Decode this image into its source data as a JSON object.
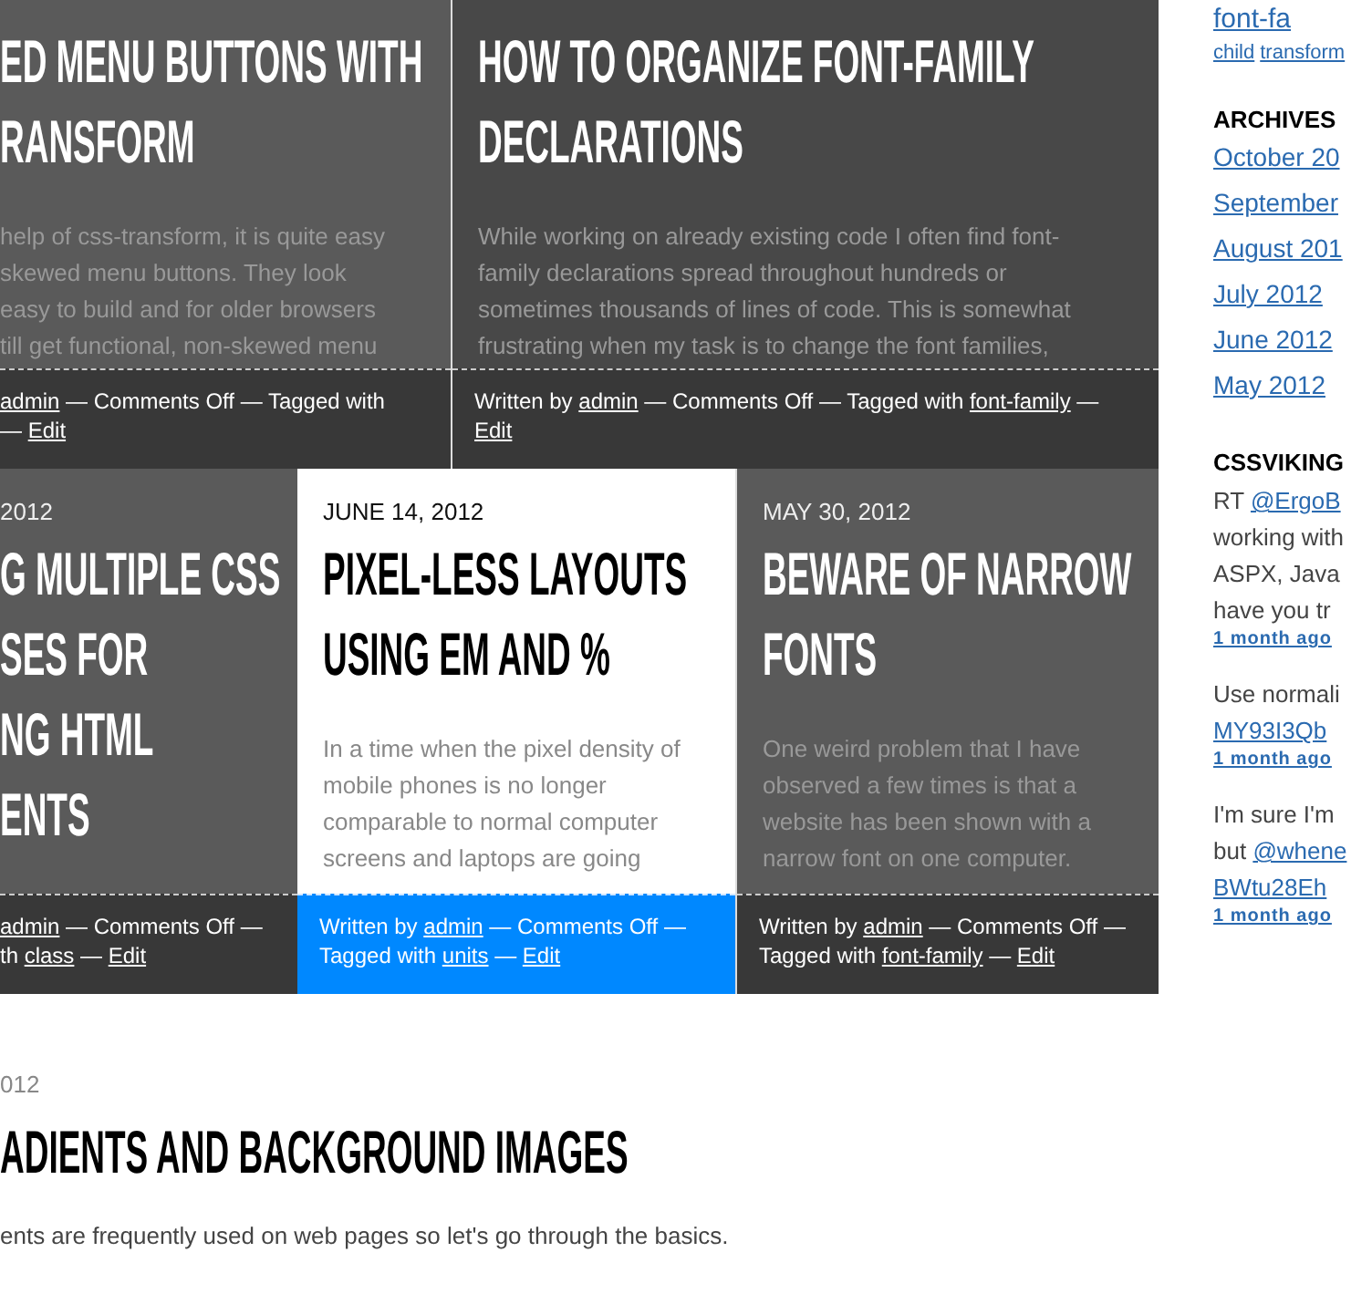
{
  "posts": [
    {
      "kind": "dark",
      "title_lines": [
        "ED MENU BUTTONS WITH",
        "RANSFORM"
      ],
      "excerpt_lines": [
        "help of css-transform, it is quite easy",
        " skewed menu buttons. They look",
        " easy to build and for older browsers",
        "till get functional, non-skewed menu"
      ],
      "footer_lines": [
        [
          {
            "kind": "link",
            "text": "admin"
          },
          {
            "kind": "text",
            "text": " — Comments Off — Tagged with"
          }
        ],
        [
          {
            "kind": "text",
            "text": "— "
          },
          {
            "kind": "link",
            "text": "Edit"
          }
        ]
      ]
    },
    {
      "kind": "darker",
      "title_lines": [
        "HOW TO ORGANIZE FONT-FAMILY",
        "DECLARATIONS"
      ],
      "excerpt_lines": [
        "While working on already existing code I often find font-",
        "family declarations spread throughout hundreds or",
        "sometimes thousands of lines of code. This is somewhat",
        "frustrating when my task is to change the font families,"
      ],
      "footer_lines": [
        [
          {
            "kind": "text",
            "text": "Written by "
          },
          {
            "kind": "link",
            "text": "admin"
          },
          {
            "kind": "text",
            "text": " — Comments Off — Tagged with "
          },
          {
            "kind": "link",
            "text": "font-family"
          },
          {
            "kind": "text",
            "text": " —"
          }
        ],
        [
          {
            "kind": "link",
            "text": "Edit"
          }
        ]
      ]
    },
    {
      "kind": "dark",
      "date": " 2012",
      "title_lines": [
        "G MULTIPLE CSS",
        "SES FOR",
        "NG HTML",
        "ENTS"
      ],
      "footer_lines": [
        [
          {
            "kind": "link",
            "text": "admin"
          },
          {
            "kind": "text",
            "text": " — Comments Off —"
          }
        ],
        [
          {
            "kind": "text",
            "text": "th "
          },
          {
            "kind": "link",
            "text": "class"
          },
          {
            "kind": "text",
            "text": " — "
          },
          {
            "kind": "link",
            "text": "Edit"
          }
        ]
      ]
    },
    {
      "kind": "light",
      "date": "JUNE 14, 2012",
      "title_lines": [
        "PIXEL-LESS LAYOUTS",
        "USING EM AND %"
      ],
      "excerpt_lines": [
        "In a time when the pixel density of",
        "mobile phones is no longer",
        "comparable to normal computer",
        "screens and laptops are going"
      ],
      "footer_lines": [
        [
          {
            "kind": "text",
            "text": "Written by "
          },
          {
            "kind": "link",
            "text": "admin"
          },
          {
            "kind": "text",
            "text": " — Comments Off —"
          }
        ],
        [
          {
            "kind": "text",
            "text": "Tagged with "
          },
          {
            "kind": "link",
            "text": "units"
          },
          {
            "kind": "text",
            "text": " — "
          },
          {
            "kind": "link",
            "text": "Edit"
          }
        ]
      ]
    },
    {
      "kind": "dark",
      "date": "MAY 30, 2012",
      "title_lines": [
        "BEWARE OF NARROW",
        "FONTS"
      ],
      "excerpt_lines": [
        "One weird problem that I have",
        "observed a few times is that a",
        "website has been shown with a",
        "narrow font on one computer."
      ],
      "footer_lines": [
        [
          {
            "kind": "text",
            "text": "Written by "
          },
          {
            "kind": "link",
            "text": "admin"
          },
          {
            "kind": "text",
            "text": " — Comments Off —"
          }
        ],
        [
          {
            "kind": "text",
            "text": "Tagged with "
          },
          {
            "kind": "link",
            "text": "font-family"
          },
          {
            "kind": "text",
            "text": " — "
          },
          {
            "kind": "link",
            "text": "Edit"
          }
        ]
      ]
    }
  ],
  "article": {
    "date": "012",
    "title": "ADIENTS AND BACKGROUND IMAGES",
    "excerpt": "ents are frequently used on web pages so let's go through the basics."
  },
  "sidebar": {
    "big_tag": "font-fa",
    "tags": [
      "child",
      "transform"
    ],
    "archives": {
      "heading": "ARCHIVES",
      "links": [
        "October 20",
        "September",
        "August 201",
        "July 2012",
        "June 2012",
        "May 2012"
      ]
    },
    "tweets": {
      "heading": "CSSVIKING",
      "items": [
        {
          "lines": [
            [
              {
                "kind": "text",
                "text": "RT "
              },
              {
                "kind": "link",
                "text": "@ErgoB"
              }
            ],
            [
              {
                "kind": "text",
                "text": "working with"
              }
            ],
            [
              {
                "kind": "text",
                "text": "ASPX, Java"
              }
            ],
            [
              {
                "kind": "text",
                "text": "have you tr"
              }
            ]
          ],
          "time": "1 month ago"
        },
        {
          "lines": [
            [
              {
                "kind": "text",
                "text": "Use normali"
              }
            ],
            [
              {
                "kind": "link",
                "text": "MY93I3Qb"
              }
            ]
          ],
          "time": "1 month ago"
        },
        {
          "lines": [
            [
              {
                "kind": "text",
                "text": "I'm sure I'm"
              }
            ],
            [
              {
                "kind": "text",
                "text": "but "
              },
              {
                "kind": "link",
                "text": "@whene"
              }
            ],
            [
              {
                "kind": "link",
                "text": "BWtu28Eh"
              }
            ]
          ],
          "time": "1 month ago"
        }
      ]
    }
  }
}
